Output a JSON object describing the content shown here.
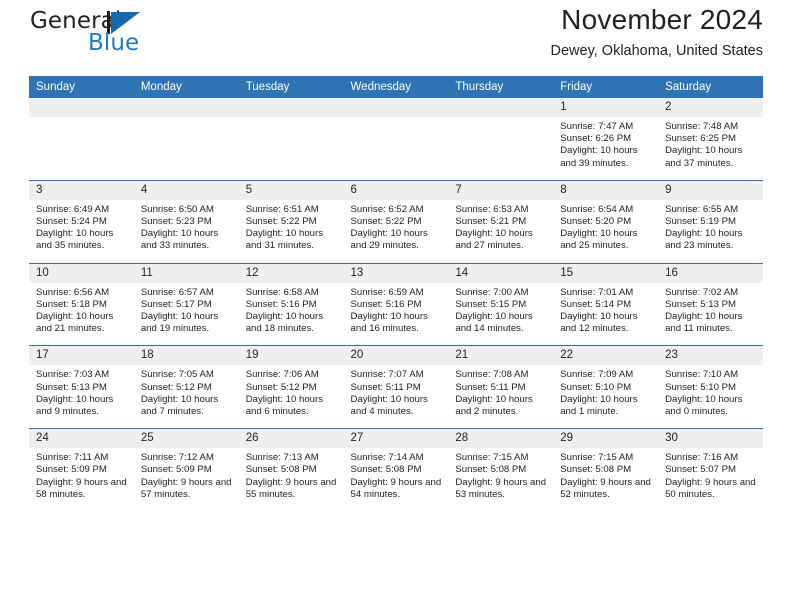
{
  "brand": {
    "name_part1": "General",
    "name_part2": "Blue",
    "logo_icon": "triangle-flag-icon"
  },
  "header": {
    "title": "November 2024",
    "subtitle": "Dewey, Oklahoma, United States"
  },
  "colors": {
    "header_blue": "#2e74b5",
    "daynum_gray": "#efefef",
    "brand_blue": "#1f7ac4",
    "text": "#231f20"
  },
  "calendar": {
    "weekday_headers": [
      "Sunday",
      "Monday",
      "Tuesday",
      "Wednesday",
      "Thursday",
      "Friday",
      "Saturday"
    ],
    "weeks": [
      [
        {
          "day": "",
          "sunrise": "",
          "sunset": "",
          "daylight": "",
          "empty": true
        },
        {
          "day": "",
          "sunrise": "",
          "sunset": "",
          "daylight": "",
          "empty": true
        },
        {
          "day": "",
          "sunrise": "",
          "sunset": "",
          "daylight": "",
          "empty": true
        },
        {
          "day": "",
          "sunrise": "",
          "sunset": "",
          "daylight": "",
          "empty": true
        },
        {
          "day": "",
          "sunrise": "",
          "sunset": "",
          "daylight": "",
          "empty": true
        },
        {
          "day": "1",
          "sunrise": "Sunrise: 7:47 AM",
          "sunset": "Sunset: 6:26 PM",
          "daylight": "Daylight: 10 hours and 39 minutes.",
          "empty": false
        },
        {
          "day": "2",
          "sunrise": "Sunrise: 7:48 AM",
          "sunset": "Sunset: 6:25 PM",
          "daylight": "Daylight: 10 hours and 37 minutes.",
          "empty": false
        }
      ],
      [
        {
          "day": "3",
          "sunrise": "Sunrise: 6:49 AM",
          "sunset": "Sunset: 5:24 PM",
          "daylight": "Daylight: 10 hours and 35 minutes.",
          "empty": false
        },
        {
          "day": "4",
          "sunrise": "Sunrise: 6:50 AM",
          "sunset": "Sunset: 5:23 PM",
          "daylight": "Daylight: 10 hours and 33 minutes.",
          "empty": false
        },
        {
          "day": "5",
          "sunrise": "Sunrise: 6:51 AM",
          "sunset": "Sunset: 5:22 PM",
          "daylight": "Daylight: 10 hours and 31 minutes.",
          "empty": false
        },
        {
          "day": "6",
          "sunrise": "Sunrise: 6:52 AM",
          "sunset": "Sunset: 5:22 PM",
          "daylight": "Daylight: 10 hours and 29 minutes.",
          "empty": false
        },
        {
          "day": "7",
          "sunrise": "Sunrise: 6:53 AM",
          "sunset": "Sunset: 5:21 PM",
          "daylight": "Daylight: 10 hours and 27 minutes.",
          "empty": false
        },
        {
          "day": "8",
          "sunrise": "Sunrise: 6:54 AM",
          "sunset": "Sunset: 5:20 PM",
          "daylight": "Daylight: 10 hours and 25 minutes.",
          "empty": false
        },
        {
          "day": "9",
          "sunrise": "Sunrise: 6:55 AM",
          "sunset": "Sunset: 5:19 PM",
          "daylight": "Daylight: 10 hours and 23 minutes.",
          "empty": false
        }
      ],
      [
        {
          "day": "10",
          "sunrise": "Sunrise: 6:56 AM",
          "sunset": "Sunset: 5:18 PM",
          "daylight": "Daylight: 10 hours and 21 minutes.",
          "empty": false
        },
        {
          "day": "11",
          "sunrise": "Sunrise: 6:57 AM",
          "sunset": "Sunset: 5:17 PM",
          "daylight": "Daylight: 10 hours and 19 minutes.",
          "empty": false
        },
        {
          "day": "12",
          "sunrise": "Sunrise: 6:58 AM",
          "sunset": "Sunset: 5:16 PM",
          "daylight": "Daylight: 10 hours and 18 minutes.",
          "empty": false
        },
        {
          "day": "13",
          "sunrise": "Sunrise: 6:59 AM",
          "sunset": "Sunset: 5:16 PM",
          "daylight": "Daylight: 10 hours and 16 minutes.",
          "empty": false
        },
        {
          "day": "14",
          "sunrise": "Sunrise: 7:00 AM",
          "sunset": "Sunset: 5:15 PM",
          "daylight": "Daylight: 10 hours and 14 minutes.",
          "empty": false
        },
        {
          "day": "15",
          "sunrise": "Sunrise: 7:01 AM",
          "sunset": "Sunset: 5:14 PM",
          "daylight": "Daylight: 10 hours and 12 minutes.",
          "empty": false
        },
        {
          "day": "16",
          "sunrise": "Sunrise: 7:02 AM",
          "sunset": "Sunset: 5:13 PM",
          "daylight": "Daylight: 10 hours and 11 minutes.",
          "empty": false
        }
      ],
      [
        {
          "day": "17",
          "sunrise": "Sunrise: 7:03 AM",
          "sunset": "Sunset: 5:13 PM",
          "daylight": "Daylight: 10 hours and 9 minutes.",
          "empty": false
        },
        {
          "day": "18",
          "sunrise": "Sunrise: 7:05 AM",
          "sunset": "Sunset: 5:12 PM",
          "daylight": "Daylight: 10 hours and 7 minutes.",
          "empty": false
        },
        {
          "day": "19",
          "sunrise": "Sunrise: 7:06 AM",
          "sunset": "Sunset: 5:12 PM",
          "daylight": "Daylight: 10 hours and 6 minutes.",
          "empty": false
        },
        {
          "day": "20",
          "sunrise": "Sunrise: 7:07 AM",
          "sunset": "Sunset: 5:11 PM",
          "daylight": "Daylight: 10 hours and 4 minutes.",
          "empty": false
        },
        {
          "day": "21",
          "sunrise": "Sunrise: 7:08 AM",
          "sunset": "Sunset: 5:11 PM",
          "daylight": "Daylight: 10 hours and 2 minutes.",
          "empty": false
        },
        {
          "day": "22",
          "sunrise": "Sunrise: 7:09 AM",
          "sunset": "Sunset: 5:10 PM",
          "daylight": "Daylight: 10 hours and 1 minute.",
          "empty": false
        },
        {
          "day": "23",
          "sunrise": "Sunrise: 7:10 AM",
          "sunset": "Sunset: 5:10 PM",
          "daylight": "Daylight: 10 hours and 0 minutes.",
          "empty": false
        }
      ],
      [
        {
          "day": "24",
          "sunrise": "Sunrise: 7:11 AM",
          "sunset": "Sunset: 5:09 PM",
          "daylight": "Daylight: 9 hours and 58 minutes.",
          "empty": false
        },
        {
          "day": "25",
          "sunrise": "Sunrise: 7:12 AM",
          "sunset": "Sunset: 5:09 PM",
          "daylight": "Daylight: 9 hours and 57 minutes.",
          "empty": false
        },
        {
          "day": "26",
          "sunrise": "Sunrise: 7:13 AM",
          "sunset": "Sunset: 5:08 PM",
          "daylight": "Daylight: 9 hours and 55 minutes.",
          "empty": false
        },
        {
          "day": "27",
          "sunrise": "Sunrise: 7:14 AM",
          "sunset": "Sunset: 5:08 PM",
          "daylight": "Daylight: 9 hours and 54 minutes.",
          "empty": false
        },
        {
          "day": "28",
          "sunrise": "Sunrise: 7:15 AM",
          "sunset": "Sunset: 5:08 PM",
          "daylight": "Daylight: 9 hours and 53 minutes.",
          "empty": false
        },
        {
          "day": "29",
          "sunrise": "Sunrise: 7:15 AM",
          "sunset": "Sunset: 5:08 PM",
          "daylight": "Daylight: 9 hours and 52 minutes.",
          "empty": false
        },
        {
          "day": "30",
          "sunrise": "Sunrise: 7:16 AM",
          "sunset": "Sunset: 5:07 PM",
          "daylight": "Daylight: 9 hours and 50 minutes.",
          "empty": false
        }
      ]
    ]
  }
}
